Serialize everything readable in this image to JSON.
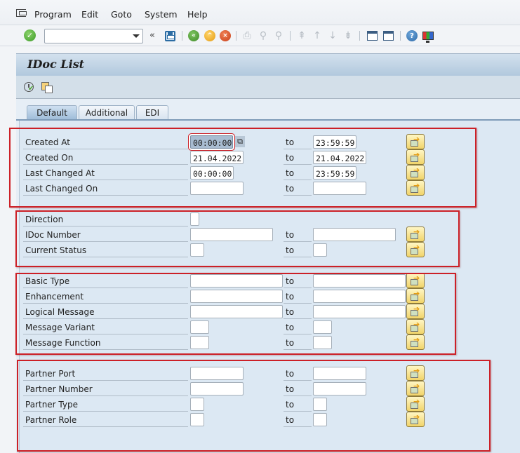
{
  "menu": {
    "items": [
      "Program",
      "Edit",
      "Goto",
      "System",
      "Help"
    ],
    "underlined": [
      "P",
      "E",
      "G",
      "S",
      "H"
    ]
  },
  "toolbar": {
    "command_field": {
      "value": "",
      "placeholder": ""
    },
    "icons": [
      "enter-icon",
      "back-chevron-icon",
      "save-icon",
      "back-icon",
      "exit-icon",
      "cancel-icon",
      "print-icon",
      "find-icon",
      "find-next-icon",
      "first-page-icon",
      "previous-page-icon",
      "next-page-icon",
      "last-page-icon",
      "new-session-icon",
      "shortcut-icon",
      "help-icon",
      "customize-layout-icon"
    ]
  },
  "page": {
    "title": "IDoc List",
    "app_icons": [
      "execute-icon",
      "get-variant-icon"
    ]
  },
  "tabs": [
    {
      "label": "Default",
      "active": true
    },
    {
      "label": "Additional",
      "active": false
    },
    {
      "label": "EDI",
      "active": false
    }
  ],
  "to_label": "to",
  "groups": [
    {
      "name": "dates",
      "rows": [
        {
          "label": "Created At",
          "from": "00:00:00",
          "to": "23:59:59",
          "focused": true
        },
        {
          "label": "Created On",
          "from": "21.04.2022",
          "to": "21.04.2022"
        },
        {
          "label": "Last Changed At",
          "from": "00:00:00",
          "to": "23:59:59"
        },
        {
          "label": "Last Changed On",
          "from": "",
          "to": ""
        }
      ]
    },
    {
      "name": "idoc",
      "rows": [
        {
          "label": "Direction",
          "from": ""
        },
        {
          "label": "IDoc Number",
          "from": "",
          "to": ""
        },
        {
          "label": "Current Status",
          "from": "",
          "to": ""
        }
      ]
    },
    {
      "name": "message",
      "rows": [
        {
          "label": "Basic Type",
          "from": "",
          "to": ""
        },
        {
          "label": "Enhancement",
          "from": "",
          "to": ""
        },
        {
          "label": "Logical Message",
          "from": "",
          "to": ""
        },
        {
          "label": "Message Variant",
          "from": "",
          "to": ""
        },
        {
          "label": "Message Function",
          "from": "",
          "to": ""
        }
      ]
    },
    {
      "name": "partner",
      "rows": [
        {
          "label": "Partner Port",
          "from": "",
          "to": ""
        },
        {
          "label": "Partner Number",
          "from": "",
          "to": ""
        },
        {
          "label": "Partner Type",
          "from": "",
          "to": ""
        },
        {
          "label": "Partner Role",
          "from": "",
          "to": ""
        }
      ]
    }
  ],
  "colors": {
    "highlight_box": "#cc2027",
    "title_bar": "#b1c8dd",
    "panel_bg": "#dce8f3"
  }
}
